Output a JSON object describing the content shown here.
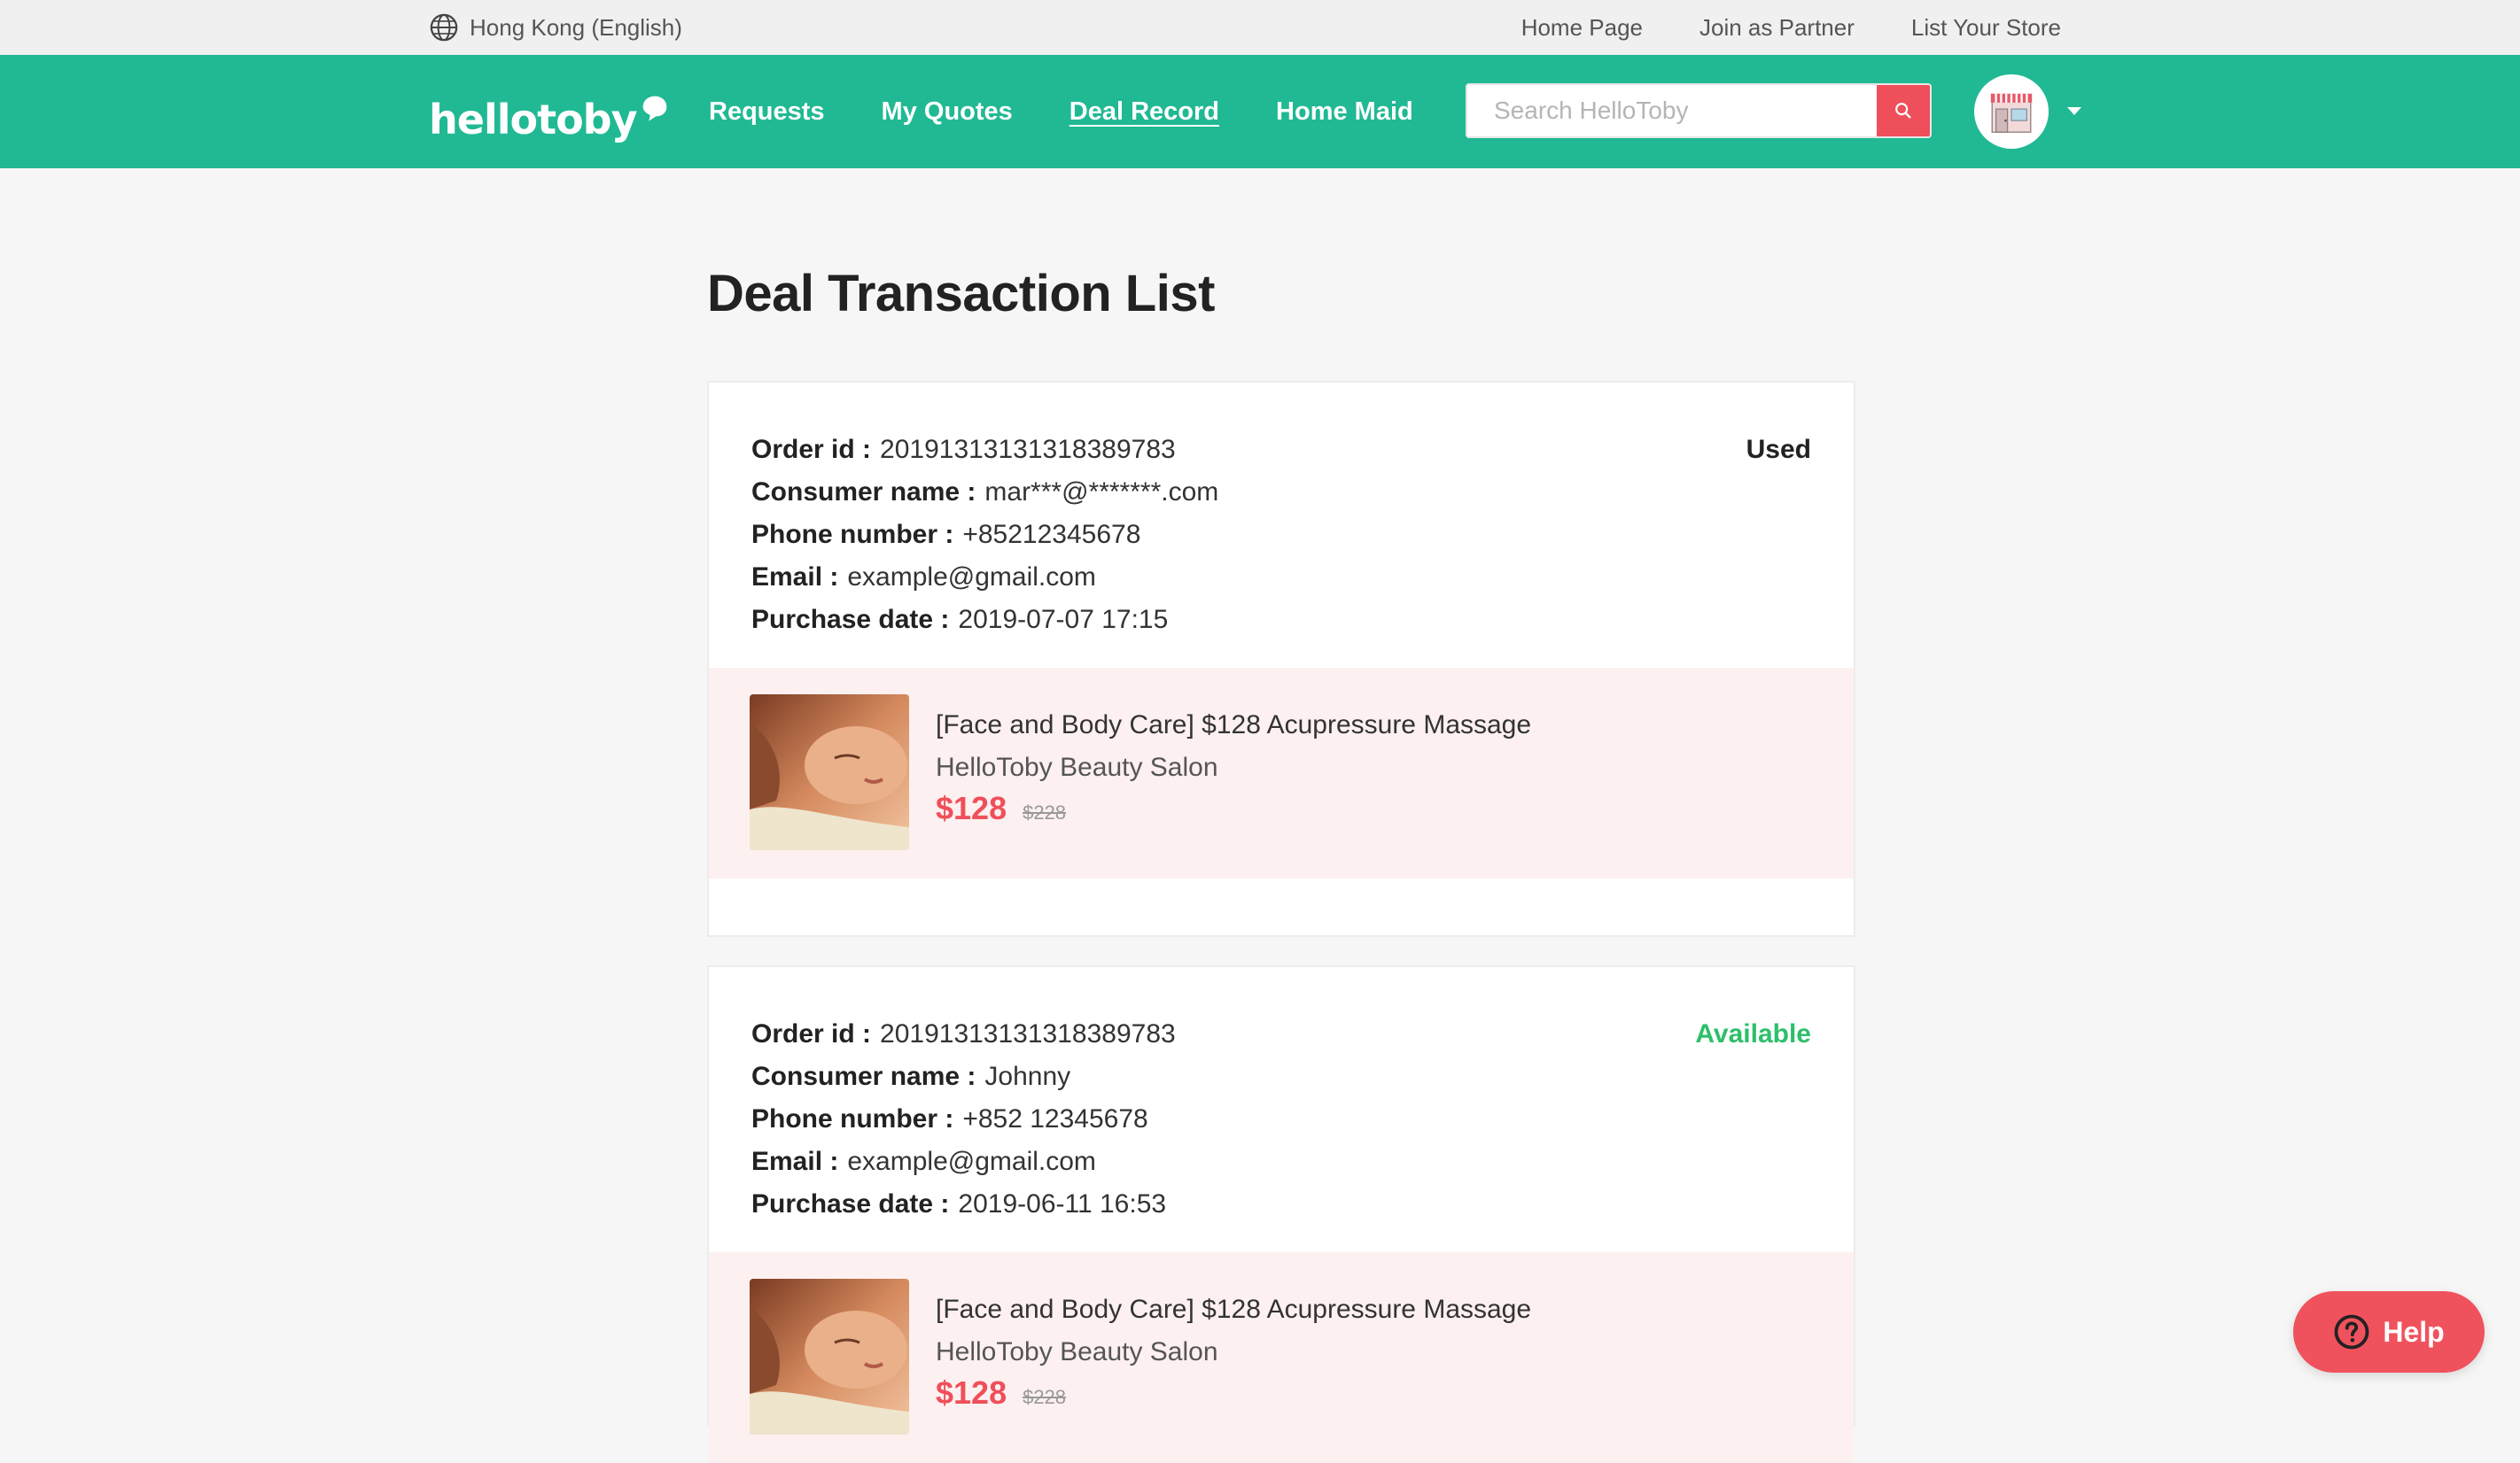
{
  "topbar": {
    "region": "Hong Kong (English)",
    "links": [
      "Home Page",
      "Join as Partner",
      "List Your Store"
    ]
  },
  "navbar": {
    "logo": "hellotoby",
    "items": [
      {
        "label": "Requests",
        "active": false
      },
      {
        "label": "My Quotes",
        "active": false
      },
      {
        "label": "Deal Record",
        "active": true
      },
      {
        "label": "Home Maid",
        "active": false
      }
    ],
    "search_placeholder": "Search HelloToby"
  },
  "colors": {
    "brand_green": "#20b993",
    "accent_red": "#ef4f5a",
    "available_green": "#2dbf6a",
    "deal_bg": "#fdf0f0"
  },
  "page": {
    "title": "Deal Transaction List",
    "labels": {
      "order_id": "Order id :",
      "consumer_name": "Consumer name :",
      "phone": "Phone number :",
      "email": "Email :",
      "purchase_date": "Purchase date :"
    }
  },
  "transactions": [
    {
      "order_id": "20191313131318389783",
      "consumer_name": "mar***@*******.com",
      "phone": "+85212345678",
      "email": "example@gmail.com",
      "purchase_date": "2019-07-07 17:15",
      "status": "Used",
      "deal": {
        "title": "[Face and Body Care] $128 Acupressure Massage",
        "store": "HelloToby Beauty Salon",
        "price": "$128",
        "original_price": "$228"
      }
    },
    {
      "order_id": "20191313131318389783",
      "consumer_name": "Johnny",
      "phone": "+852 12345678",
      "email": "example@gmail.com",
      "purchase_date": "2019-06-11 16:53",
      "status": "Available",
      "deal": {
        "title": "[Face and Body Care] $128 Acupressure Massage",
        "store": "HelloToby Beauty Salon",
        "price": "$128",
        "original_price": "$228"
      }
    }
  ],
  "help": {
    "label": "Help"
  }
}
